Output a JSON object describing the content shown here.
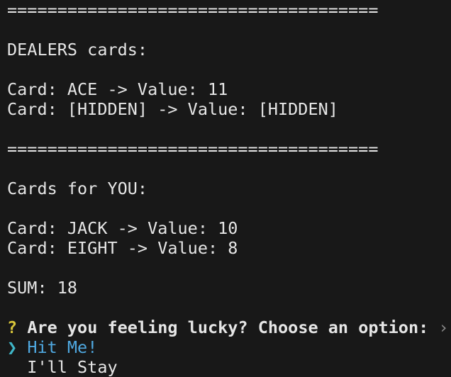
{
  "terminal": {
    "separator_top": "=====================================",
    "dealer_heading": "DEALERS cards:",
    "dealer_cards": [
      "Card: ACE -> Value: 11",
      "Card: [HIDDEN] -> Value: [HIDDEN]"
    ],
    "separator_mid": "=====================================",
    "player_heading": "Cards for YOU:",
    "player_cards": [
      "Card: JACK -> Value: 10",
      "Card: EIGHT -> Value: 8"
    ],
    "sum_line": "SUM: 18",
    "prompt": {
      "question_mark": "?",
      "text": "Are you feeling lucky? Choose an option:",
      "hint_icon": "›"
    },
    "options": {
      "pointer": "❯",
      "items": [
        "Hit Me!",
        "I'll Stay"
      ],
      "selected_index": 0
    }
  },
  "colors": {
    "background": "#181818",
    "text": "#e6e6e6",
    "prompt_question_mark": "#d8c53a",
    "pointer": "#3fb6c8",
    "selected_option": "#4fa8e0"
  }
}
